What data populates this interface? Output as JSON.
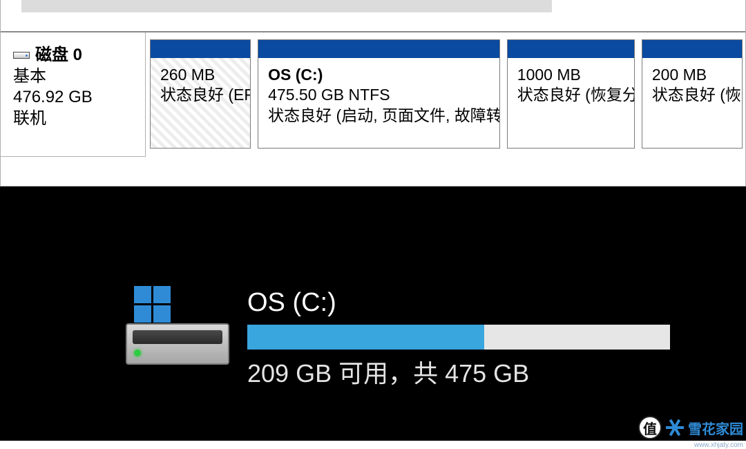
{
  "disk_mgmt": {
    "disk": {
      "name": "磁盘 0",
      "type": "基本",
      "capacity": "476.92 GB",
      "state": "联机"
    },
    "partitions": [
      {
        "name": "",
        "size": "260 MB",
        "status": "状态良好 (EFI",
        "hatched": true
      },
      {
        "name": "OS  (C:)",
        "size": "475.50 GB NTFS",
        "status": "状态良好 (启动, 页面文件, 故障转储",
        "hatched": false
      },
      {
        "name": "",
        "size": "1000 MB",
        "status": "状态良好 (恢复分",
        "hatched": false
      },
      {
        "name": "",
        "size": "200 MB",
        "status": "状态良好 (恢",
        "hatched": false
      }
    ]
  },
  "explorer": {
    "drive_title": "OS (C:)",
    "free_text": "209 GB 可用，共 475 GB",
    "used_percent": 56
  },
  "watermark": {
    "zhi": "值",
    "brand": "雪花家园",
    "url": "www.xhjaty.com"
  }
}
